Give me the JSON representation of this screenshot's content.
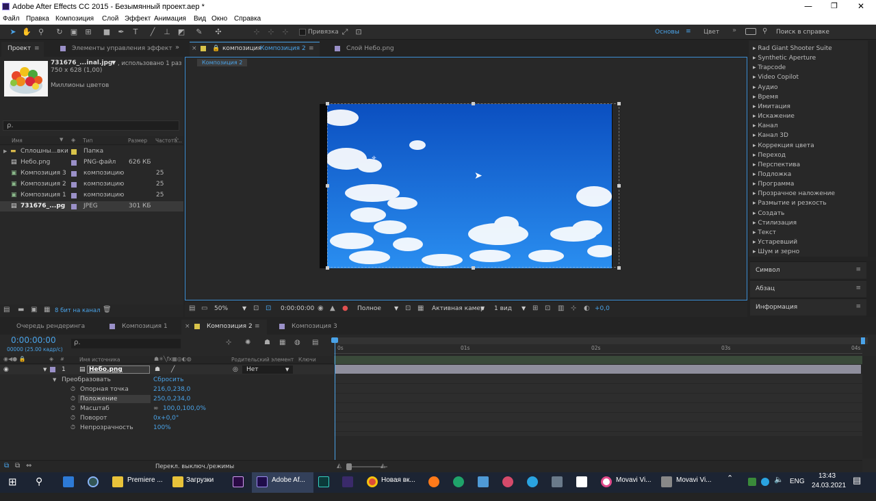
{
  "window": {
    "title": "Adobe After Effects CC 2015 - Безымянный проект.aep *"
  },
  "menu": [
    "Файл",
    "Правка",
    "Композиция",
    "Слой",
    "Эффект",
    "Анимация",
    "Вид",
    "Окно",
    "Справка"
  ],
  "toolbar": {
    "snap_label": "Привязка",
    "workspace": "Основы",
    "workspace2": "Цвет",
    "search_placeholder": "Поиск в справке"
  },
  "project": {
    "tab": "Проект",
    "tab2": "Элементы управления эффект",
    "asset": {
      "name": "731676_...inal.jpg",
      "usage": ", использовано 1 раз",
      "dims": "750 x 628 (1,00)",
      "colors": "Миллионы цветов"
    },
    "search": "ρ.",
    "columns": [
      "Имя",
      "Тип",
      "Размер",
      "Частота..."
    ],
    "items": [
      {
        "name": "Сплошны...вки",
        "type": "Папка",
        "size": "",
        "fps": ""
      },
      {
        "name": "Небо.png",
        "type": "PNG-файл",
        "size": "626 КБ",
        "fps": ""
      },
      {
        "name": "Композиция 3",
        "type": "композицию",
        "size": "",
        "fps": "25"
      },
      {
        "name": "Композиция 2",
        "type": "композицию",
        "size": "",
        "fps": "25"
      },
      {
        "name": "Композиция 1",
        "type": "композицию",
        "size": "",
        "fps": "25"
      },
      {
        "name": "731676_...pg",
        "type": "JPEG",
        "size": "301 КБ",
        "fps": ""
      }
    ],
    "bits": "8 бит на канал"
  },
  "viewer": {
    "tab_prefix": "композиция",
    "tab_name": "Композиция 2",
    "tab2": "Слой Небо.png",
    "crumb": "Композиция 2",
    "zoom": "50%",
    "time": "0:00:00:00",
    "res": "Полное",
    "camera": "Активная камер",
    "views": "1 вид",
    "exposure": "+0,0"
  },
  "effects": [
    "Rad Giant Shooter Suite",
    "Synthetic Aperture",
    "Trapcode",
    "Video Copilot",
    "Аудио",
    "Время",
    "Имитация",
    "Искажение",
    "Канал",
    "Канал 3D",
    "Коррекция цвета",
    "Переход",
    "Перспектива",
    "Подложка",
    "Программа",
    "Прозрачное наложение",
    "Размытие и резкость",
    "Создать",
    "Стилизация",
    "Текст",
    "Устаревший",
    "Шум и зерно"
  ],
  "panels": [
    "Символ",
    "Абзац",
    "Информация"
  ],
  "timeline": {
    "tabs": [
      "Очередь рендеринга",
      "Композиция 1",
      "Композиция 2",
      "Композиция 3"
    ],
    "time": "0:00:00:00",
    "fps": "00000 (25.00 кадр/с)",
    "search": "ρ.",
    "col_source": "Имя источника",
    "col_parent": "Родительский элемент",
    "col_keys": "Ключи",
    "layer": {
      "num": "1",
      "name": "Небо.png",
      "parent": "Нет"
    },
    "transform": "Преобразовать",
    "reset": "Сбросить",
    "props": [
      {
        "name": "Опорная точка",
        "value": "216,0,238,0"
      },
      {
        "name": "Положение",
        "value": "250,0,234,0"
      },
      {
        "name": "Масштаб",
        "value": "100,0,100,0%"
      },
      {
        "name": "Поворот",
        "value": "0x+0,0°"
      },
      {
        "name": "Непрозрачность",
        "value": "100%"
      }
    ],
    "ruler": [
      "0s",
      "01s",
      "02s",
      "03s",
      "04s"
    ],
    "footer": "Перекл. выключ./режимы"
  },
  "taskbar": {
    "apps": [
      "Premiere ...",
      "Загрузки",
      "Adobe Af...",
      "Новая вк...",
      "Movavi Vi...",
      "Movavi Vi..."
    ],
    "lang": "ENG",
    "clock": "13:43",
    "date": "24.03.2021"
  },
  "colors": {
    "accent": "#4aa3e8",
    "label_yellow": "#d9c44a",
    "label_purple": "#9a90c8",
    "sky": "#1d7fe0"
  }
}
